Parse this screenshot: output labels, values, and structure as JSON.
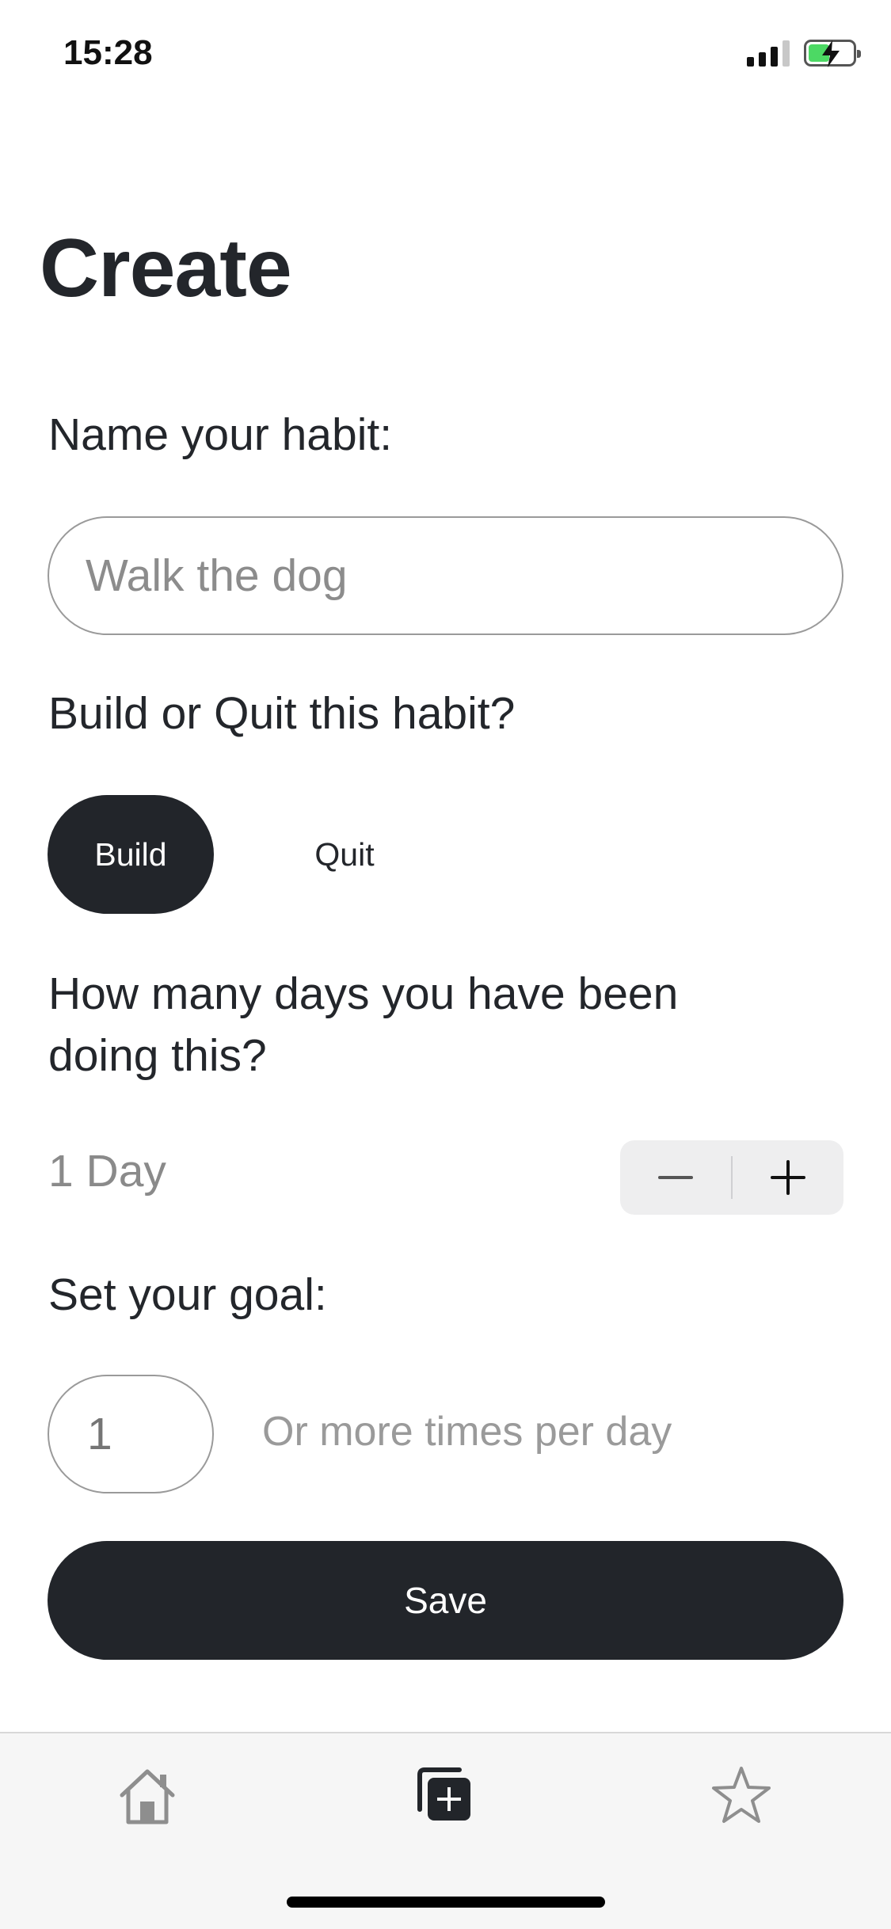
{
  "status_bar": {
    "time": "15:28"
  },
  "page": {
    "title": "Create"
  },
  "name_section": {
    "label": "Name your habit:",
    "input_value": "",
    "input_placeholder": "Walk the dog"
  },
  "type_section": {
    "label": "Build or Quit this habit?",
    "options": [
      "Build",
      "Quit"
    ],
    "selected": "Build"
  },
  "days_section": {
    "label": "How many days you have been doing this?",
    "value_text": "1 Day"
  },
  "goal_section": {
    "label": "Set your goal:",
    "input_value": "",
    "input_placeholder": "1",
    "suffix": "Or more times per day"
  },
  "save_label": "Save",
  "tab_bar": {
    "tabs": [
      {
        "icon": "home-icon",
        "active": false
      },
      {
        "icon": "add-copy-icon",
        "active": true
      },
      {
        "icon": "star-icon",
        "active": false
      }
    ]
  },
  "colors": {
    "primary_dark": "#22252a",
    "text": "#23262b",
    "muted": "#8a8a8a",
    "tab_bar_bg": "#f6f6f6",
    "battery_green": "#4cd964"
  }
}
